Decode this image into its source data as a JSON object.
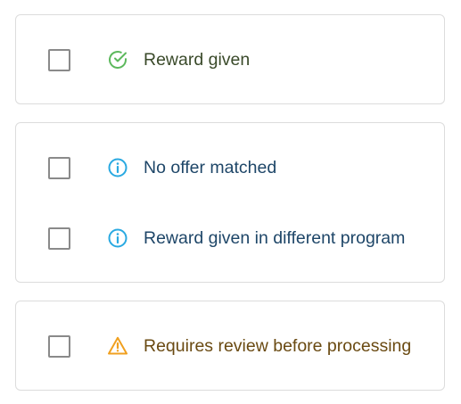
{
  "colors": {
    "success": "#5cb85c",
    "info": "#29a9e1",
    "warning": "#f0a020",
    "checkbox_border": "#8a8a8a",
    "card_border": "#dcdcdc"
  },
  "groups": [
    {
      "status": "success",
      "items": [
        {
          "label": "Reward given",
          "icon": "check-circle-icon",
          "checked": false
        }
      ]
    },
    {
      "status": "info",
      "items": [
        {
          "label": "No offer matched",
          "icon": "info-circle-icon",
          "checked": false
        },
        {
          "label": "Reward given in different program",
          "icon": "info-circle-icon",
          "checked": false
        }
      ]
    },
    {
      "status": "warning",
      "items": [
        {
          "label": "Requires review before processing",
          "icon": "warning-triangle-icon",
          "checked": false
        }
      ]
    }
  ]
}
